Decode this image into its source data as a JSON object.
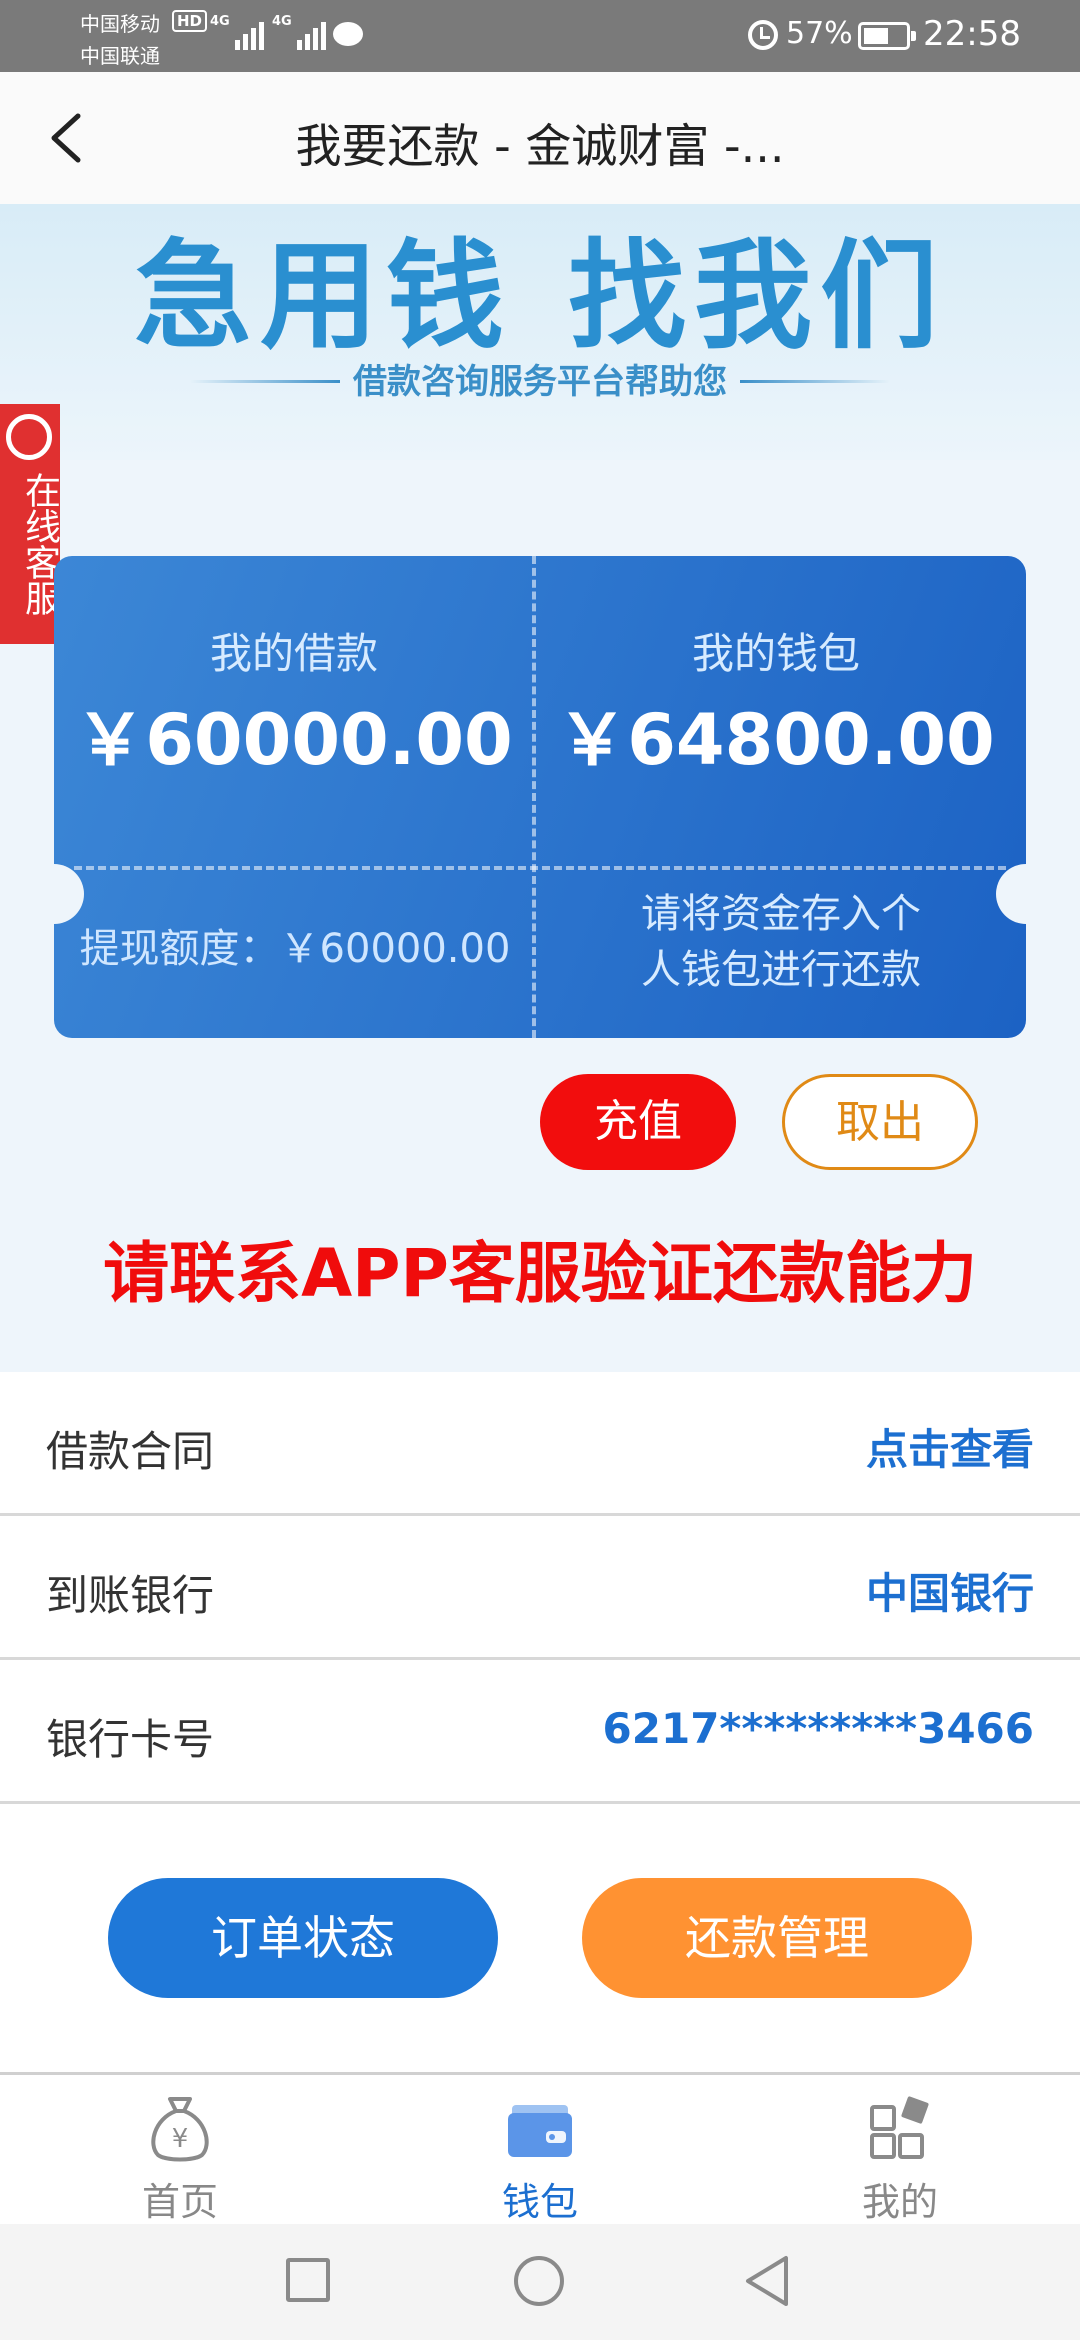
{
  "status_bar": {
    "carrier_1": "中国移动",
    "carrier_2": "中国联通",
    "hd_badge": "HD",
    "net_1": "4G",
    "net_2": "4G",
    "battery": "57%",
    "time": "22:58"
  },
  "header": {
    "title": "我要还款 - 金诚财富 -..."
  },
  "banner": {
    "title_part1": "急用钱",
    "title_part2": "找我们",
    "subtitle": "借款咨询服务平台帮助您"
  },
  "service_tab": {
    "label": "在线客服"
  },
  "card": {
    "loan_label": "我的借款",
    "loan_amount": "￥60000.00",
    "wallet_label": "我的钱包",
    "wallet_amount": "￥64800.00",
    "limit_text": "提现额度：￥60000.00",
    "tip_line1": "请将资金存入个",
    "tip_line2": "人钱包进行还款"
  },
  "actions": {
    "recharge": "充值",
    "withdraw": "取出"
  },
  "warning": "请联系APP客服验证还款能力",
  "info_rows": [
    {
      "label": "借款合同",
      "value": "点击查看"
    },
    {
      "label": "到账银行",
      "value": "中国银行"
    },
    {
      "label": "银行卡号",
      "value": "6217*********3466"
    }
  ],
  "buttons": {
    "order_status": "订单状态",
    "repay_manage": "还款管理"
  },
  "tabs": [
    {
      "label": "首页",
      "icon": "money-bag-icon"
    },
    {
      "label": "钱包",
      "icon": "wallet-icon"
    },
    {
      "label": "我的",
      "icon": "grid-icon"
    }
  ],
  "colors": {
    "primary_blue": "#1f78d8",
    "warning_red": "#f20d0d",
    "accent_orange": "#ff9232"
  }
}
